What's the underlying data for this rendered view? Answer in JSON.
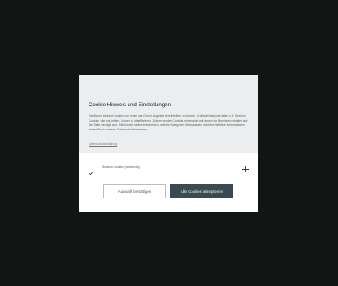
{
  "dialog": {
    "title": "Cookie Hinweis und Einstellungen",
    "body": "Edelbauer benutzt Cookies um Ihnen das Online-Angebot bereitstellen zu können. In diese Kategorie fallen z.B. Session Cookies, die uns helfen, Nutzer zu identifizieren. Zudem werden Cookies eingesetzt, mit denen der Benutzerverhalten auf der Seite verfolgt wird. Sie können selbst entscheiden, welche Kategorien Sie zulassen möchten. Weitere Informationen finden Sie in unseren Datenschutzhinweisen.",
    "privacy_link": "Datenschutzerklärung",
    "checkbox_label": "Session Cookies (notwendig)",
    "checkbox_checked": true,
    "btn_select": "Auswahl bestätigen",
    "btn_accept_all": "Alle Cookies akzeptieren",
    "colors": {
      "backdrop": "#111513",
      "header_bg": "#ecedee",
      "primary_button": "#394b50"
    },
    "icons": {
      "check": "check-icon",
      "expand": "plus-icon"
    }
  }
}
